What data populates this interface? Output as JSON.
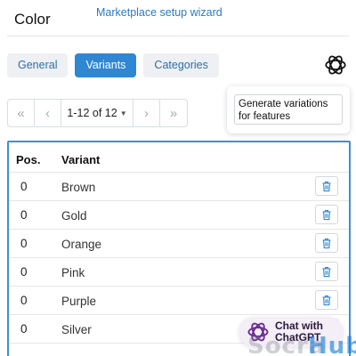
{
  "header": {
    "title": "Color",
    "wizard_link": "Marketplace setup wizard"
  },
  "tabs": [
    {
      "label": "General",
      "active": false
    },
    {
      "label": "Variants",
      "active": true
    },
    {
      "label": "Categories",
      "active": false
    }
  ],
  "pagination": {
    "first": "«",
    "prev": "‹",
    "range": "1-12 of 12",
    "next": "›",
    "last": "»"
  },
  "generate_button": "Generate variations for features",
  "table": {
    "headers": {
      "pos": "Pos.",
      "variant": "Variant"
    },
    "rows": [
      {
        "pos": "0",
        "variant": "Brown"
      },
      {
        "pos": "0",
        "variant": "Gold"
      },
      {
        "pos": "0",
        "variant": "Orange"
      },
      {
        "pos": "0",
        "variant": "Pink"
      },
      {
        "pos": "0",
        "variant": "Purple"
      },
      {
        "pos": "0",
        "variant": "Silver"
      }
    ]
  },
  "chat": {
    "line1": "Chat with",
    "line2": "ChatGPT"
  },
  "watermark": {
    "part1": "Socra",
    "part2": "Hub"
  },
  "colors": {
    "accent": "#2f86d2",
    "link": "#2b7bbf",
    "table_border": "#3d8fd8"
  },
  "icons": [
    "openai-logo-icon",
    "trash-icon",
    "caret-down-icon"
  ]
}
